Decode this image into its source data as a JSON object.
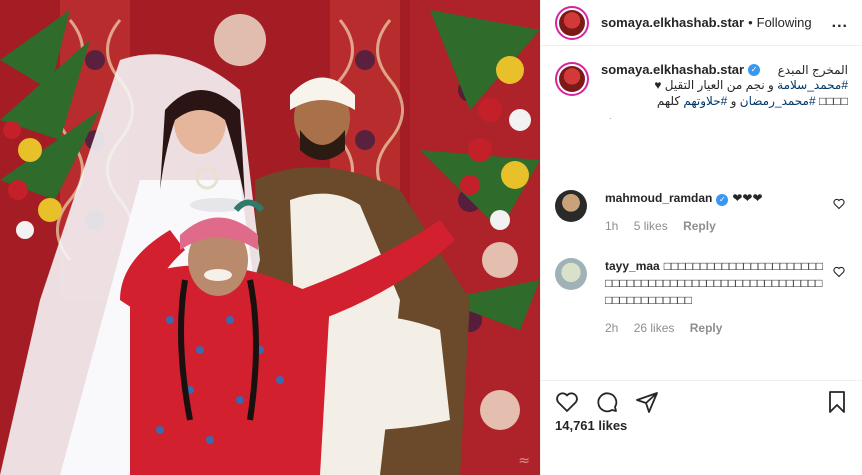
{
  "post": {
    "username": "somaya.elkhashab.star",
    "follow_status": "Following",
    "more": "...",
    "separator": "•"
  },
  "caption": {
    "username": "somaya.elkhashab.star",
    "verified_badge": "✓",
    "line1": "المخرج المبدع",
    "line2_hash": "#محمد_سلامة",
    "line2_rest": "و نجم من العيار التقيل ♥",
    "line3_emoji": "□□□□",
    "line3_hash1": "#محمد_رمضان",
    "line3_mid": "و",
    "line3_hash2": "#حلاوتهم",
    "line3_end": "كلهم",
    "line4": "."
  },
  "comments": [
    {
      "username": "mahmoud_ramdan",
      "verified": "✓",
      "text": "❤❤❤",
      "time": "1h",
      "likes": "5 likes",
      "reply": "Reply"
    },
    {
      "username": "tayy_maa",
      "text": "□□□□□□□□□□□□□□□□□□□□□□□□□□□□□□□□□□□□□□□□□□□□□□□□□□□□□□□□□□□□□□□□",
      "time": "2h",
      "likes": "26 likes",
      "reply": "Reply"
    }
  ],
  "actions": {
    "like_icon": "heart-outline-icon",
    "comment_icon": "comment-icon",
    "share_icon": "send-icon",
    "save_icon": "bookmark-icon"
  },
  "likes_count": "14,761 likes",
  "colors": {
    "verified": "#3897f0",
    "hashtag": "#00376b",
    "muted": "#8e8e8e",
    "story_ring": "#d6249f"
  }
}
